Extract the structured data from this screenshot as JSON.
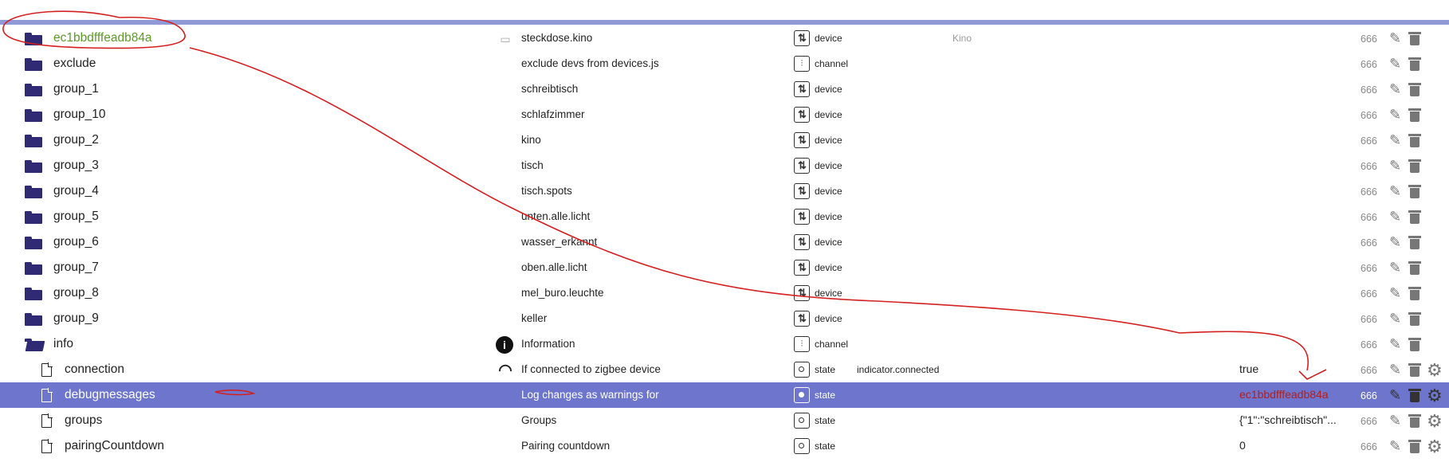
{
  "rows": [
    {
      "id": "ec1bbdfffeadb84a",
      "kind": "folder",
      "name": "steckdose.kino",
      "type": "device",
      "room": "Kino",
      "acl": "666",
      "icon": "plug-icon",
      "green": true
    },
    {
      "id": "exclude",
      "kind": "folder",
      "name": "exclude devs from devices.js",
      "type": "channel",
      "acl": "666"
    },
    {
      "id": "group_1",
      "kind": "folder",
      "name": "schreibtisch",
      "type": "device",
      "acl": "666"
    },
    {
      "id": "group_10",
      "kind": "folder",
      "name": "schlafzimmer",
      "type": "device",
      "acl": "666"
    },
    {
      "id": "group_2",
      "kind": "folder",
      "name": "kino",
      "type": "device",
      "acl": "666"
    },
    {
      "id": "group_3",
      "kind": "folder",
      "name": "tisch",
      "type": "device",
      "acl": "666"
    },
    {
      "id": "group_4",
      "kind": "folder",
      "name": "tisch.spots",
      "type": "device",
      "acl": "666"
    },
    {
      "id": "group_5",
      "kind": "folder",
      "name": "unten.alle.licht",
      "type": "device",
      "acl": "666"
    },
    {
      "id": "group_6",
      "kind": "folder",
      "name": "wasser_erkannt",
      "type": "device",
      "acl": "666"
    },
    {
      "id": "group_7",
      "kind": "folder",
      "name": "oben.alle.licht",
      "type": "device",
      "acl": "666"
    },
    {
      "id": "group_8",
      "kind": "folder",
      "name": "mel_buro.leuchte",
      "type": "device",
      "acl": "666"
    },
    {
      "id": "group_9",
      "kind": "folder",
      "name": "keller",
      "type": "device",
      "acl": "666"
    },
    {
      "id": "info",
      "kind": "folder-open",
      "name": "Information",
      "type": "channel",
      "acl": "666",
      "icon": "info-icon"
    },
    {
      "id": "connection",
      "kind": "file",
      "name": "If connected to zigbee device",
      "type": "state",
      "role": "indicator.connected",
      "value": "true",
      "acl": "666",
      "icon": "wifi-icon"
    },
    {
      "id": "debugmessages",
      "kind": "file",
      "name": "Log changes as warnings for",
      "type": "state",
      "value": "ec1bbdfffeadb84a",
      "acl": "666",
      "selected": true,
      "redValue": true
    },
    {
      "id": "groups",
      "kind": "file",
      "name": "Groups",
      "type": "state",
      "value": "{\"1\":\"schreibtisch\"...",
      "acl": "666"
    },
    {
      "id": "pairingCountdown",
      "kind": "file",
      "name": "Pairing countdown",
      "type": "state",
      "value": "0",
      "acl": "666"
    }
  ],
  "icons": {
    "device_glyph": "⇅",
    "info_glyph": "i",
    "wifi_glyph": "◠",
    "plug_glyph": "▭",
    "edit_glyph": "✎",
    "settings_glyph": "⚙"
  },
  "colors": {
    "folder": "#2f2a73",
    "selected_row": "#6d76cc",
    "annotation": "#d42020",
    "green_id": "#5b9a27"
  }
}
